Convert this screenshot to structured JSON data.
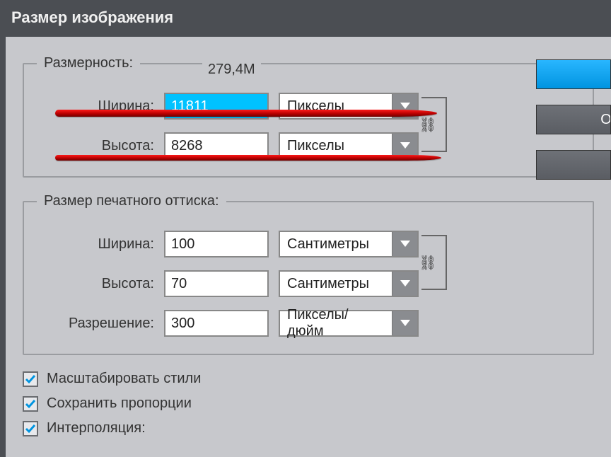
{
  "title": "Размер изображения",
  "dimensions": {
    "legend": "Размерность:",
    "size_value": "279,4M",
    "width_label": "Ширина:",
    "width_value": "11811",
    "width_unit": "Пикселы",
    "height_label": "Высота:",
    "height_value": "8268",
    "height_unit": "Пикселы"
  },
  "print": {
    "legend": "Размер печатного оттиска:",
    "width_label": "Ширина:",
    "width_value": "100",
    "width_unit": "Сантиметры",
    "height_label": "Высота:",
    "height_value": "70",
    "height_unit": "Сантиметры",
    "res_label": "Разрешение:",
    "res_value": "300",
    "res_unit": "Пикселы/дюйм"
  },
  "checks": {
    "scale_styles": "Масштабировать стили",
    "keep_ratio": "Сохранить пропорции",
    "interpolation": "Интерполяция:"
  },
  "buttons": {
    "ok": "",
    "cancel": "О",
    "auto": ""
  },
  "icons": {
    "link": "⛓",
    "check": "✔"
  }
}
